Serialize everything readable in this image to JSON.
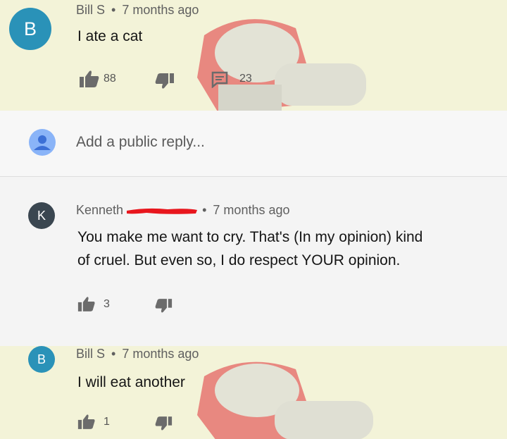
{
  "comments": [
    {
      "avatar_letter": "B",
      "author": "Bill S",
      "separator": "•",
      "time": "7 months ago",
      "text": "I ate a cat",
      "likes": "88",
      "replies": "23",
      "avatar_color": "#2a92b8"
    },
    {
      "avatar_letter": "K",
      "author": "Kenneth",
      "separator": "•",
      "time": "7 months ago",
      "text_line1": "You make me want to cry. That's (In my opinion) kind",
      "text_line2": "of cruel. But even so, I do respect YOUR opinion.",
      "likes": "3",
      "avatar_color": "#3a4650"
    },
    {
      "avatar_letter": "B",
      "author": "Bill S",
      "separator": "•",
      "time": "7 months ago",
      "text": "I will eat another",
      "likes": "1",
      "avatar_color": "#2a92b8"
    }
  ],
  "reply_box": {
    "placeholder": "Add a public reply...",
    "avatar_color": "#8ab4f8"
  },
  "icons": [
    "thumbs-up-icon",
    "thumbs-down-icon",
    "reply-icon",
    "user-avatar-icon"
  ],
  "colors": {
    "redaction": "#e8161d",
    "watermark_red": "#e0313a"
  }
}
